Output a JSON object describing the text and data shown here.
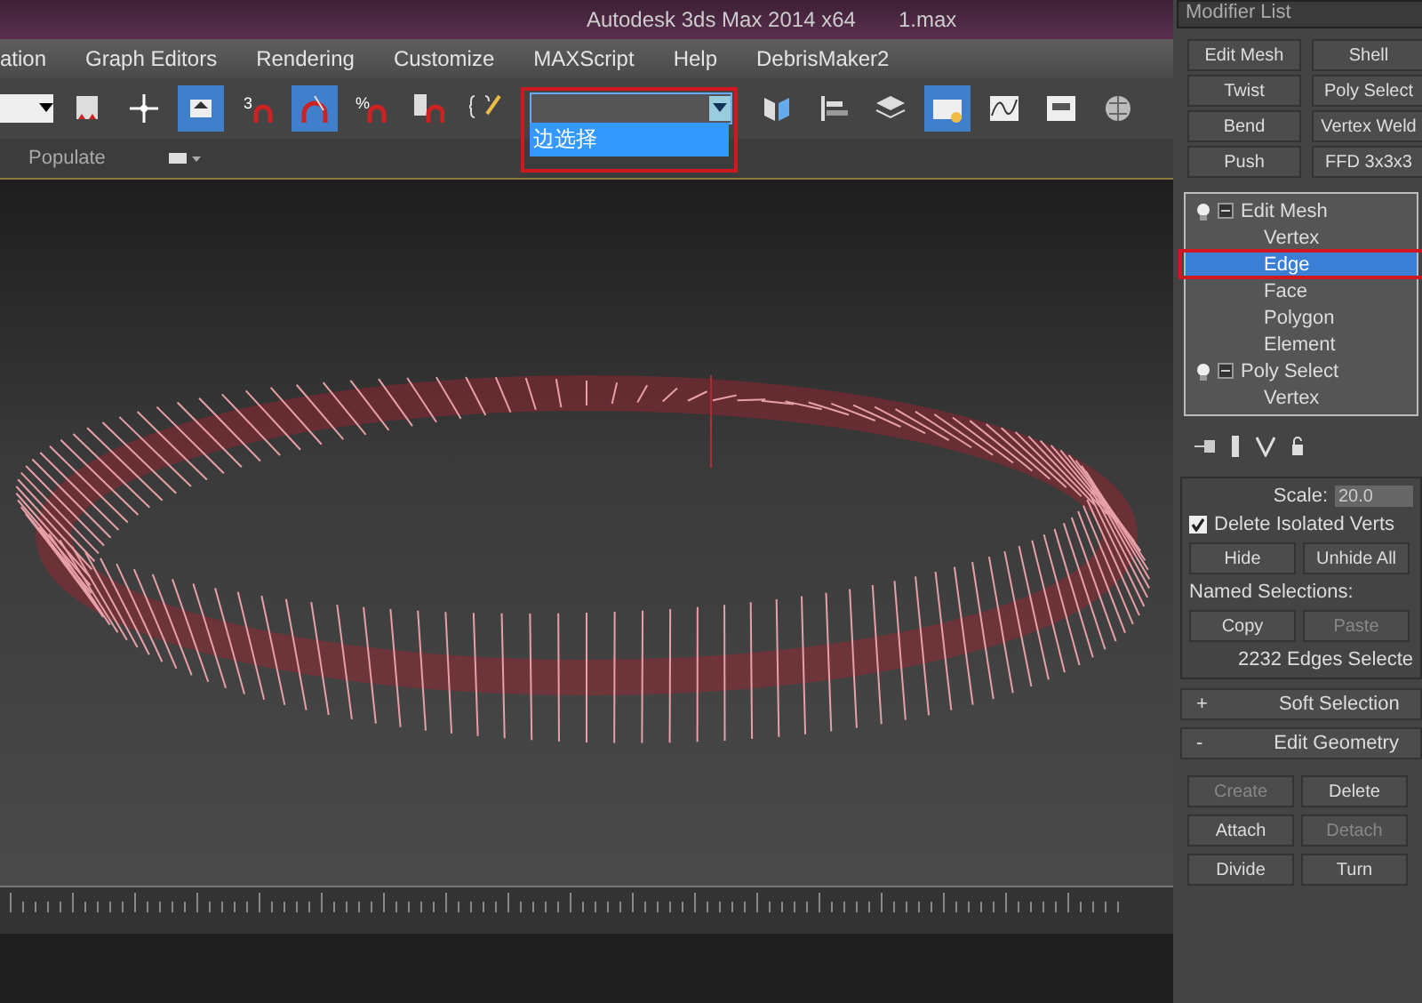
{
  "window": {
    "title": "Autodesk 3ds Max  2014 x64",
    "file": "1.max"
  },
  "menu": [
    "ation",
    "Graph Editors",
    "Rendering",
    "Customize",
    "MAXScript",
    "Help",
    "DebrisMaker2"
  ],
  "toolbar": {
    "icons_before": [
      {
        "kind": "bookmark",
        "selected": false
      },
      {
        "kind": "move",
        "selected": false
      },
      {
        "kind": "select",
        "selected": true
      },
      {
        "kind": "snap",
        "glyph": "3",
        "selected": false
      },
      {
        "kind": "angle",
        "selected": true
      },
      {
        "kind": "percent",
        "glyph": "%",
        "selected": false
      },
      {
        "kind": "spinner",
        "selected": false
      },
      {
        "kind": "named",
        "selected": false
      }
    ],
    "selection_set": {
      "options": [
        {
          "label": "边选择",
          "selected": true
        }
      ],
      "expanded": true,
      "highlighted": true
    },
    "icons_after": [
      {
        "kind": "mirror",
        "selected": false
      },
      {
        "kind": "align",
        "selected": false
      },
      {
        "kind": "layers",
        "selected": false
      },
      {
        "kind": "explorer",
        "selected": true
      },
      {
        "kind": "curve",
        "selected": false
      },
      {
        "kind": "schematic",
        "selected": false
      },
      {
        "kind": "material",
        "selected": false
      }
    ]
  },
  "ribbon": {
    "tab": "Populate"
  },
  "panel": {
    "title": "Modifier List",
    "modifier_buttons": [
      "Edit Mesh",
      "Shell",
      "Twist",
      "Poly Select",
      "Bend",
      "Vertex Weld",
      "Push",
      "FFD 3x3x3"
    ],
    "stack": [
      {
        "label": "Edit Mesh",
        "expanded": true,
        "selected": false,
        "children": [
          {
            "label": "Vertex",
            "selected": false
          },
          {
            "label": "Edge",
            "selected": true,
            "highlighted": true
          },
          {
            "label": "Face",
            "selected": false
          },
          {
            "label": "Polygon",
            "selected": false
          },
          {
            "label": "Element",
            "selected": false
          }
        ]
      },
      {
        "label": "Poly Select",
        "expanded": true,
        "selected": false,
        "children": [
          {
            "label": "Vertex",
            "selected": false
          }
        ]
      }
    ],
    "scale_label": "Scale:",
    "scale_value": "20.0",
    "delete_isolated": {
      "label": "Delete Isolated Verts",
      "checked": true
    },
    "hide_buttons": [
      {
        "label": "Hide",
        "disabled": false
      },
      {
        "label": "Unhide All",
        "disabled": false
      }
    ],
    "named_label": "Named Selections:",
    "named_buttons": [
      {
        "label": "Copy",
        "disabled": false
      },
      {
        "label": "Paste",
        "disabled": true
      }
    ],
    "status": "2232 Edges Selecte",
    "rollouts": [
      {
        "sign": "+",
        "label": "Soft Selection"
      },
      {
        "sign": "-",
        "label": "Edit Geometry"
      }
    ],
    "geometry_buttons": [
      {
        "label": "Create",
        "disabled": true
      },
      {
        "label": "Delete",
        "disabled": false
      },
      {
        "label": "Attach",
        "disabled": false
      },
      {
        "label": "Detach",
        "disabled": true
      },
      {
        "label": "Divide",
        "disabled": false
      },
      {
        "label": "Turn",
        "disabled": false
      }
    ]
  }
}
